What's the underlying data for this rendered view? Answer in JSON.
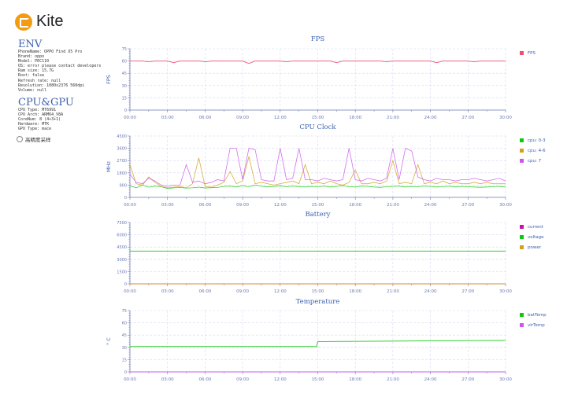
{
  "app": {
    "name": "Kite"
  },
  "env": {
    "title": "ENV",
    "lines": [
      "PhoneName: OPPO Find X5 Pro",
      "Brand: oppo",
      "Model: PEC110",
      "OS: error please contact developers",
      "Ram size: 15.7G",
      "Root: false",
      "Refresh rate: null",
      "Resolution: 1080x2376 560dpi",
      "Volume: null"
    ]
  },
  "cpugpu": {
    "title": "CPU&GPU",
    "lines": [
      "CPU Type: MT6991",
      "CPU Arch: ARM64_V8A",
      "CoreNum: 8 (4+3+1)",
      "Hardware: MTK",
      "GPU Type: mace"
    ]
  },
  "options": {
    "high_precision_label": "高精度采样",
    "high_precision_checked": false
  },
  "chart_data": [
    {
      "type": "line",
      "title": "FPS",
      "ylabel": "FPS",
      "ylim": [
        0,
        75
      ],
      "yticks": [
        "0",
        "15",
        "30",
        "45",
        "60",
        "75"
      ],
      "xticks": [
        "00:00",
        "03:00",
        "06:00",
        "09:00",
        "12:00",
        "15:00",
        "18:00",
        "21:00",
        "24:00",
        "27:00",
        "30:00"
      ],
      "xlim_minutes": [
        0,
        30
      ],
      "legend_position": "right",
      "series": [
        {
          "name": "FPS",
          "color": "#f0506e",
          "values": [
            60,
            60,
            60,
            59,
            60,
            60,
            60,
            58,
            60,
            60,
            60,
            60,
            59,
            60,
            60,
            60,
            60,
            60,
            60,
            57,
            60,
            60,
            60,
            60,
            60,
            59,
            60,
            60,
            60,
            60,
            60,
            60,
            60,
            58,
            60,
            60,
            60,
            60,
            60,
            60,
            60,
            59,
            60,
            60,
            60,
            60,
            60,
            60,
            60,
            58,
            60,
            60,
            60,
            60,
            60,
            59,
            60,
            60,
            60,
            60,
            60
          ]
        }
      ]
    },
    {
      "type": "line",
      "title": "CPU Clock",
      "ylabel": "MHz",
      "ylim": [
        0,
        4500
      ],
      "yticks": [
        "0",
        "900",
        "1800",
        "2700",
        "3600",
        "4500"
      ],
      "xticks": [
        "00:00",
        "03:00",
        "06:00",
        "09:00",
        "12:00",
        "15:00",
        "18:00",
        "21:00",
        "24:00",
        "27:00",
        "30:00"
      ],
      "xlim_minutes": [
        0,
        30
      ],
      "legend_position": "right",
      "series": [
        {
          "name": "cpu: 0-3",
          "color": "#11c811",
          "values": [
            850,
            700,
            900,
            750,
            820,
            780,
            650,
            700,
            720,
            680,
            700,
            750,
            690,
            710,
            730,
            800,
            820,
            760,
            850,
            780,
            900,
            820,
            760,
            800,
            840,
            780,
            820,
            790,
            760,
            800,
            780,
            820,
            760,
            800,
            850,
            780,
            760,
            820,
            800,
            760,
            740,
            780,
            800,
            820,
            760,
            800,
            780,
            820,
            800,
            760,
            780,
            820,
            760,
            800,
            780,
            760,
            740,
            760,
            780,
            800,
            760
          ]
        },
        {
          "name": "cpu: 4-6",
          "color": "#d4a017",
          "values": [
            2400,
            1000,
            900,
            1500,
            1100,
            800,
            700,
            750,
            800,
            700,
            1000,
            2900,
            800,
            750,
            900,
            1100,
            1900,
            1000,
            1200,
            3000,
            1000,
            1100,
            1000,
            900,
            1000,
            1100,
            1200,
            1000,
            2400,
            1000,
            1100,
            1000,
            1200,
            1000,
            900,
            1100,
            2000,
            1000,
            1000,
            1100,
            1000,
            1200,
            2700,
            1000,
            1100,
            1000,
            2400,
            1000,
            1100,
            1000,
            1200,
            1000,
            1100,
            1000,
            1000,
            1100,
            1000,
            1100,
            1000,
            1000,
            1000
          ]
        },
        {
          "name": "cpu: 7",
          "color": "#cc55ee",
          "values": [
            1700,
            1100,
            1000,
            1400,
            1200,
            900,
            800,
            900,
            900,
            2400,
            1100,
            1200,
            1000,
            1100,
            1300,
            1200,
            3600,
            3600,
            1300,
            3600,
            3500,
            1300,
            1200,
            1200,
            3600,
            1300,
            1400,
            3600,
            1300,
            1300,
            1200,
            1400,
            1300,
            1200,
            1300,
            3600,
            1300,
            1200,
            1400,
            1300,
            1200,
            1400,
            3600,
            1300,
            3600,
            3400,
            1500,
            1300,
            1200,
            1400,
            1300,
            1300,
            1200,
            1300,
            1300,
            1400,
            1300,
            1200,
            1300,
            1400,
            1200
          ]
        }
      ]
    },
    {
      "type": "line",
      "title": "Battery",
      "ylabel": "",
      "ylim": [
        0,
        7500
      ],
      "yticks": [
        "0",
        "1500",
        "3000",
        "4500",
        "6000",
        "7500"
      ],
      "xticks": [
        "00:00",
        "03:00",
        "06:00",
        "09:00",
        "12:00",
        "15:00",
        "18:00",
        "21:00",
        "24:00",
        "27:00",
        "30:00"
      ],
      "xlim_minutes": [
        0,
        30
      ],
      "legend_position": "right",
      "series": [
        {
          "name": "current",
          "color": "#cc11aa",
          "values": [
            0,
            0
          ]
        },
        {
          "name": "voltage",
          "color": "#11c811",
          "values": [
            4000,
            4000
          ]
        },
        {
          "name": "power",
          "color": "#d4a017",
          "values": [
            0,
            0
          ]
        }
      ]
    },
    {
      "type": "line",
      "title": "Temperature",
      "ylabel": "° C",
      "ylim": [
        0,
        75
      ],
      "yticks": [
        "0",
        "15",
        "30",
        "45",
        "60",
        "75"
      ],
      "xticks": [
        "00:00",
        "03:00",
        "06:00",
        "09:00",
        "12:00",
        "15:00",
        "18:00",
        "21:00",
        "24:00",
        "27:00",
        "30:00"
      ],
      "xlim_minutes": [
        0,
        30
      ],
      "legend_position": "right",
      "series": [
        {
          "name": "batTemp",
          "color": "#11c811",
          "points": [
            [
              0,
              31
            ],
            [
              14.9,
              31
            ],
            [
              15,
              37
            ],
            [
              23.5,
              38
            ],
            [
              30,
              38.5
            ]
          ]
        },
        {
          "name": "virTemp",
          "color": "#cc55ee",
          "points": [
            [
              0,
              0
            ],
            [
              30,
              0
            ]
          ]
        }
      ]
    }
  ]
}
